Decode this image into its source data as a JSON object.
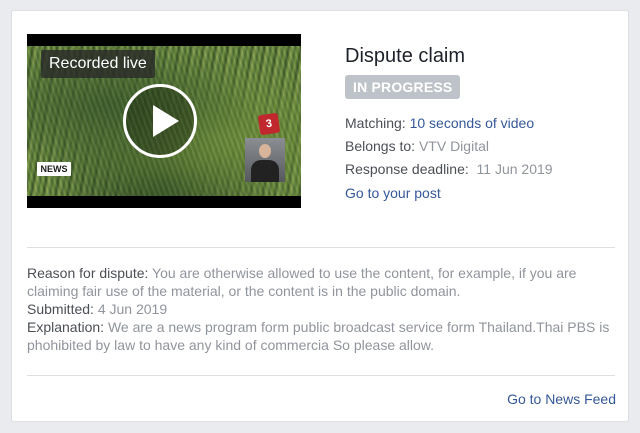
{
  "video": {
    "label": "Recorded live",
    "news_logo": "NEWS",
    "channel_logo": "3"
  },
  "claim": {
    "title": "Dispute claim",
    "status": "IN PROGRESS",
    "matching_label": "Matching:",
    "matching_value": "10 seconds of video",
    "belongs_label": "Belongs to:",
    "belongs_value": "VTV Digital",
    "deadline_label": "Response deadline:",
    "deadline_value": "11 Jun 2019",
    "post_link": "Go to your post"
  },
  "details": {
    "reason_label": "Reason for dispute:",
    "reason_value": "You are otherwise allowed to use the content, for example, if you are claiming fair use of the material, or the content is in the public domain.",
    "submitted_label": "Submitted:",
    "submitted_value": "4 Jun 2019",
    "explanation_label": "Explanation:",
    "explanation_value": "We are a news program form public broadcast service form Thailand.Thai PBS is phohibited by law to have any kind of commercia So please allow."
  },
  "footer": {
    "news_feed_link": "Go to News Feed"
  },
  "colors": {
    "link": "#365899",
    "badge": "#bec3c9",
    "muted": "#90949c"
  }
}
